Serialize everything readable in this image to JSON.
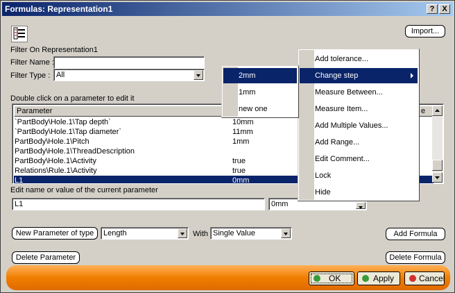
{
  "window": {
    "title": "Formulas: Representation1",
    "help_glyph": "?",
    "close_glyph": "X"
  },
  "toolbar": {
    "import_label": "Import..."
  },
  "filter": {
    "heading": "Filter On Representation1",
    "name_label": "Filter Name :",
    "name_value": "",
    "type_label": "Filter Type :",
    "type_value": "All"
  },
  "params": {
    "instruction": "Double click on a parameter to edit it",
    "header": "Parameter",
    "header_tail": "e",
    "rows": [
      {
        "name": "`PartBody\\Hole.1\\Tap depth`",
        "value": "10mm"
      },
      {
        "name": "`PartBody\\Hole.1\\Tap diameter`",
        "value": "11mm"
      },
      {
        "name": "PartBody\\Hole.1\\Pitch",
        "value": "1mm"
      },
      {
        "name": "PartBody\\Hole.1\\ThreadDescription",
        "value": ""
      },
      {
        "name": "PartBody\\Hole.1\\Activity",
        "value": "true"
      },
      {
        "name": "Relations\\Rule.1\\Activity",
        "value": "true"
      },
      {
        "name": "L1",
        "value": "0mm"
      }
    ]
  },
  "edit": {
    "label": "Edit name or value of the current parameter",
    "name_value": "L1",
    "value_value": "0mm"
  },
  "new_param": {
    "button_label": "New Parameter of type",
    "type_value": "Length",
    "with_label": "With",
    "with_value": "Single Value",
    "add_formula_label": "Add Formula"
  },
  "delete": {
    "param_label": "Delete Parameter",
    "formula_label": "Delete Formula"
  },
  "dialog_buttons": {
    "ok": "OK",
    "apply": "Apply",
    "cancel": "Cancel"
  },
  "context_menu": {
    "items": [
      "Add tolerance...",
      "Change step",
      "Measure Between...",
      "Measure Item...",
      "Add Multiple Values...",
      "Add Range...",
      "Edit Comment...",
      "Lock",
      "Hide"
    ],
    "highlighted": "Change step"
  },
  "submenu": {
    "items": [
      "2mm",
      "1mm",
      "new one"
    ],
    "highlighted": "2mm"
  },
  "colors": {
    "titlebar": "#0a246a",
    "selection": "#0a246a",
    "bottom_bar": "#f07e00"
  }
}
